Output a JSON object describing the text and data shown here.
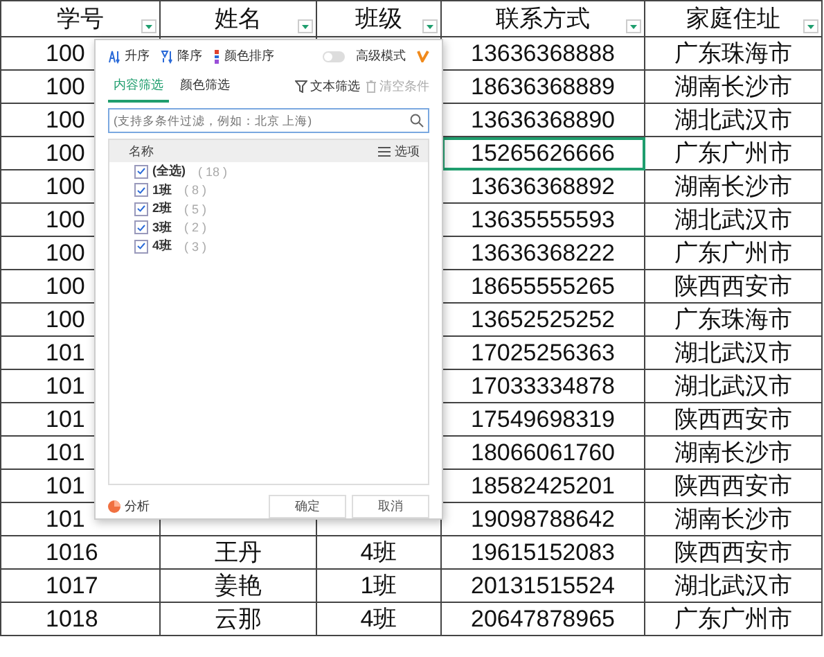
{
  "table": {
    "columns": [
      {
        "label": "学号"
      },
      {
        "label": "姓名"
      },
      {
        "label": "班级"
      },
      {
        "label": "联系方式"
      },
      {
        "label": "家庭住址"
      }
    ],
    "rows": [
      {
        "id": "100",
        "phone": "13636368888",
        "address": "广东珠海市",
        "active": false
      },
      {
        "id": "100",
        "phone": "18636368889",
        "address": "湖南长沙市",
        "active": false
      },
      {
        "id": "100",
        "phone": "13636368890",
        "address": "湖北武汉市",
        "active": false
      },
      {
        "id": "100",
        "phone": "15265626666",
        "address": "广东广州市",
        "active": true
      },
      {
        "id": "100",
        "phone": "13636368892",
        "address": "湖南长沙市",
        "active": false
      },
      {
        "id": "100",
        "phone": "13635555593",
        "address": "湖北武汉市",
        "active": false
      },
      {
        "id": "100",
        "phone": "13636368222",
        "address": "广东广州市",
        "active": false
      },
      {
        "id": "100",
        "phone": "18655555265",
        "address": "陕西西安市",
        "active": false
      },
      {
        "id": "100",
        "phone": "13652525252",
        "address": "广东珠海市",
        "active": false
      },
      {
        "id": "101",
        "phone": "17025256363",
        "address": "湖北武汉市",
        "active": false
      },
      {
        "id": "101",
        "phone": "17033334878",
        "address": "湖北武汉市",
        "active": false
      },
      {
        "id": "101",
        "phone": "17549698319",
        "address": "陕西西安市",
        "active": false
      },
      {
        "id": "101",
        "phone": "18066061760",
        "address": "湖南长沙市",
        "active": false
      },
      {
        "id": "101",
        "phone": "18582425201",
        "address": "陕西西安市",
        "active": false
      },
      {
        "id": "101",
        "phone": "19098788642",
        "address": "湖南长沙市",
        "active": false
      },
      {
        "id": "1016",
        "name": "王丹",
        "class": "4班",
        "phone": "19615152083",
        "address": "陕西西安市",
        "active": false
      },
      {
        "id": "1017",
        "name": "姜艳",
        "class": "1班",
        "phone": "20131515524",
        "address": "湖北武汉市",
        "active": false
      },
      {
        "id": "1018",
        "name": "云那",
        "class": "4班",
        "phone": "20647878965",
        "address": "广东广州市",
        "active": false
      }
    ]
  },
  "filter_popup": {
    "sort_buttons": [
      {
        "kind": "asc",
        "label": "升序"
      },
      {
        "kind": "desc",
        "label": "降序"
      },
      {
        "kind": "color",
        "label": "颜色排序"
      }
    ],
    "advanced_mode": {
      "label": "高级模式",
      "on": false
    },
    "tabs": [
      {
        "label": "内容筛选",
        "selected": true
      },
      {
        "label": "颜色筛选",
        "selected": false
      }
    ],
    "text_filter": {
      "label": "文本筛选"
    },
    "clear_conditions": {
      "label": "清空条件",
      "disabled": true
    },
    "search": {
      "placeholder": "(支持多条件过滤，例如：北京 上海)"
    },
    "list_header": {
      "name": "名称",
      "options": "选项"
    },
    "items": [
      {
        "label": "(全选)",
        "count": "( 18 )",
        "checked": true
      },
      {
        "label": "1班",
        "count": "( 8 )",
        "checked": true
      },
      {
        "label": "2班",
        "count": "( 5 )",
        "checked": true
      },
      {
        "label": "3班",
        "count": "( 2 )",
        "checked": true
      },
      {
        "label": "4班",
        "count": "( 3 )",
        "checked": true
      }
    ],
    "analysis": "分析",
    "buttons": [
      "确定",
      "取消"
    ]
  }
}
